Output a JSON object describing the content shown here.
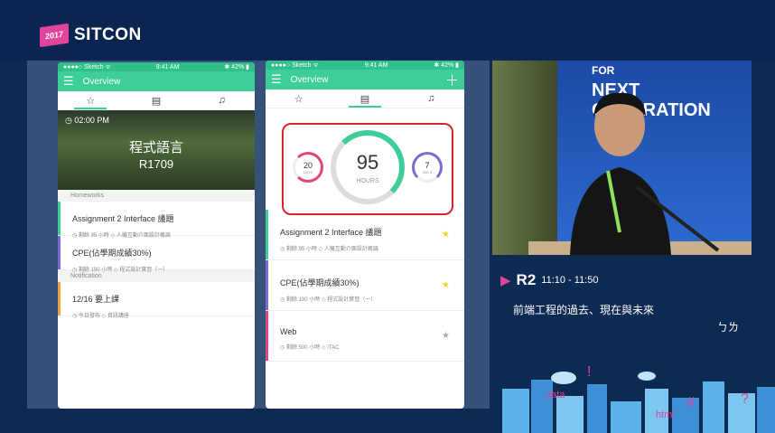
{
  "brand": {
    "badge": "2017",
    "name": "SITCON"
  },
  "phone1": {
    "status": {
      "carrier": "●●●●○ Sketch ᯤ",
      "time": "9:41 AM",
      "battery": "✱ 42% ▮"
    },
    "appbar_title": "Overview",
    "hero": {
      "time": "◷ 02:00 PM",
      "course": "程式語言",
      "room": "R1709"
    },
    "sections": {
      "homeworks": "Homeworks",
      "notification": "Notification"
    },
    "cards": [
      {
        "title": "Assignment 2 Interface 議題",
        "meta": "◷ 剩餘 95 小時   ◇ 人機互動介面設計概論",
        "color": "#3ecf98"
      },
      {
        "title": "CPE(佔學期成績30%)",
        "meta": "◷ 剩餘 190 小時   ◇ 程式設計實習（一）",
        "color": "#7b6ad6"
      },
      {
        "title": "12/16 要上課",
        "meta": "◷ 今日發布   ◇ 資訊講座",
        "color": "#f0a040"
      }
    ]
  },
  "phone2": {
    "status": {
      "carrier": "●●●●○ Sketch ᯤ",
      "time": "9:41 AM",
      "battery": "✱ 42% ▮"
    },
    "appbar_title": "Overview",
    "stats": {
      "left": {
        "value": "20",
        "unit": "DAYS"
      },
      "center": {
        "value": "95",
        "unit": "HOURS"
      },
      "right": {
        "value": "7",
        "unit": "DAYS"
      }
    },
    "cards": [
      {
        "title": "Assignment 2 Interface 議題",
        "meta": "◷ 剩餘 95 小時   ◇ 人機互動介面設計概論",
        "color": "#3ecf98",
        "star": "★",
        "star_color": "#f2d21b"
      },
      {
        "title": "CPE(佔學期成績30%)",
        "meta": "◷ 剩餘 190 小時   ◇ 程式設計實習（一）",
        "color": "#7b6ad6",
        "star": "★",
        "star_color": "#f2d21b"
      },
      {
        "title": "Web",
        "meta": "◷ 剩餘 500 小時   ◇ ITAC",
        "color": "#e0457b",
        "star": "★",
        "star_color": "#aaaaaa"
      }
    ]
  },
  "stage_banner": {
    "line1": "FOR",
    "line2": "NEXT",
    "line3": "GENERATION"
  },
  "session": {
    "room": "R2",
    "time": "11:10 - 11:50",
    "title": "前端工程的過去、現在與未來",
    "speaker": "ㄅㄌ"
  },
  "footer_words": {
    "data": "data",
    "html": "html"
  }
}
